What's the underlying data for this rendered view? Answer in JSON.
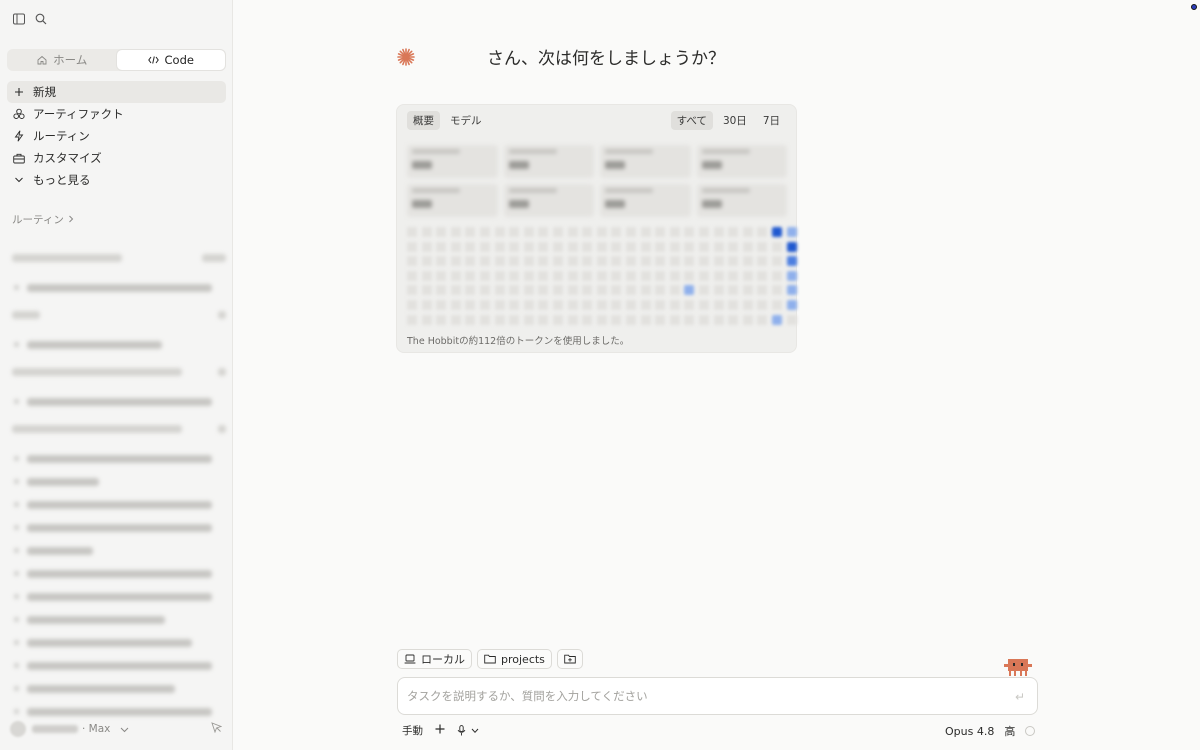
{
  "sidebar": {
    "segment": {
      "home": "ホーム",
      "code": "Code"
    },
    "nav": [
      {
        "label": "新規",
        "icon": "plus-icon"
      },
      {
        "label": "アーティファクト",
        "icon": "artifact-icon"
      },
      {
        "label": "ルーティン",
        "icon": "bolt-icon"
      },
      {
        "label": "カスタマイズ",
        "icon": "briefcase-icon"
      },
      {
        "label": "もっと見る",
        "icon": "chevron-down-icon"
      }
    ],
    "section_title": "ルーティン",
    "plan": "· Max"
  },
  "main": {
    "greeting": "さん、次は何をしましょうか？",
    "card": {
      "tabs_left": [
        "概要",
        "モデル"
      ],
      "tabs_right": [
        "すべて",
        "30日",
        "7日"
      ],
      "note": "The Hobbitの約112倍のトークンを使用しました。"
    },
    "chips": {
      "local": "ローカル",
      "folder": "projects"
    },
    "input_placeholder": "タスクを説明するか、質問を入力してください",
    "bottom": {
      "mode": "手動",
      "model": "Opus 4.8",
      "effort": "高"
    }
  },
  "colors": {
    "accent": "#d97757",
    "heat_dark": "#1f58cf"
  }
}
